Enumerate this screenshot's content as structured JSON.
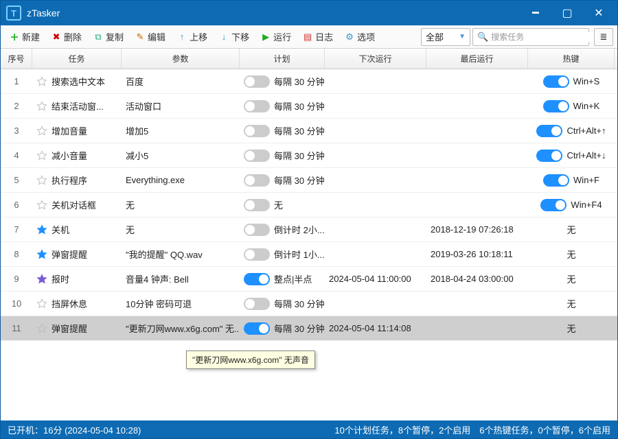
{
  "title": "zTasker",
  "toolbar": {
    "new": "新建",
    "del": "删除",
    "copy": "复制",
    "edit": "编辑",
    "up": "上移",
    "down": "下移",
    "run": "运行",
    "log": "日志",
    "opt": "选项",
    "category": "全部",
    "search_placeholder": "搜索任务"
  },
  "columns": {
    "idx": "序号",
    "task": "任务",
    "param": "参数",
    "plan": "计划",
    "next": "下次运行",
    "last": "最后运行",
    "hot": "热键"
  },
  "rows": [
    {
      "idx": "1",
      "star": "off",
      "task": "搜索选中文本",
      "param": "百度",
      "on": false,
      "plan": "每隔 30 分钟",
      "next": "",
      "last": "",
      "hot": "Win+S",
      "hoton": true
    },
    {
      "idx": "2",
      "star": "off",
      "task": "结束活动窗...",
      "param": "活动窗口",
      "on": false,
      "plan": "每隔 30 分钟",
      "next": "",
      "last": "",
      "hot": "Win+K",
      "hoton": true
    },
    {
      "idx": "3",
      "star": "off",
      "task": "增加音量",
      "param": "增加5",
      "on": false,
      "plan": "每隔 30 分钟",
      "next": "",
      "last": "",
      "hot": "Ctrl+Alt+↑",
      "hoton": true
    },
    {
      "idx": "4",
      "star": "off",
      "task": "减小音量",
      "param": "减小5",
      "on": false,
      "plan": "每隔 30 分钟",
      "next": "",
      "last": "",
      "hot": "Ctrl+Alt+↓",
      "hoton": true
    },
    {
      "idx": "5",
      "star": "off",
      "task": "执行程序",
      "param": "Everything.exe",
      "on": false,
      "plan": "每隔 30 分钟",
      "next": "",
      "last": "",
      "hot": "Win+F",
      "hoton": true
    },
    {
      "idx": "6",
      "star": "off",
      "task": "关机对话框",
      "param": "无",
      "on": false,
      "plan": "无",
      "next": "",
      "last": "",
      "hot": "Win+F4",
      "hoton": true
    },
    {
      "idx": "7",
      "star": "blue",
      "task": "关机",
      "param": "无",
      "on": false,
      "plan": "倒计时 2小...",
      "next": "",
      "last": "2018-12-19 07:26:18",
      "hot": "无",
      "hoton": false
    },
    {
      "idx": "8",
      "star": "blue",
      "task": "弹窗提醒",
      "param": "\"我的提醒\" QQ.wav",
      "on": false,
      "plan": "倒计时 1小...",
      "next": "",
      "last": "2019-03-26 10:18:11",
      "hot": "无",
      "hoton": false
    },
    {
      "idx": "9",
      "star": "purple",
      "task": "报时",
      "param": "音量4 钟声: Bell",
      "on": true,
      "plan": "整点|半点",
      "next": "2024-05-04 11:00:00",
      "last": "2018-04-24 03:00:00",
      "hot": "无",
      "hoton": false
    },
    {
      "idx": "10",
      "star": "off",
      "task": "挡屏休息",
      "param": "10分钟 密码可退",
      "on": false,
      "plan": "每隔 30 分钟",
      "next": "",
      "last": "",
      "hot": "无",
      "hoton": false
    },
    {
      "idx": "11",
      "star": "off",
      "task": "弹窗提醒",
      "param": "\"更新刀网www.x6g.com\" 无...",
      "on": true,
      "plan": "每隔 30 分钟",
      "next": "2024-05-04 11:14:08",
      "last": "",
      "hot": "无",
      "hoton": false,
      "sel": true
    }
  ],
  "tooltip": "\"更新刀网www.x6g.com\" 无声音",
  "status": {
    "left": "已开机：16分 (2024-05-04 10:28)",
    "right": "10个计划任务，8个暂停，2个启用　6个热键任务，0个暂停，6个启用"
  },
  "colors": {
    "accent": "#0e6bb3",
    "toggle_on": "#1e90ff"
  }
}
